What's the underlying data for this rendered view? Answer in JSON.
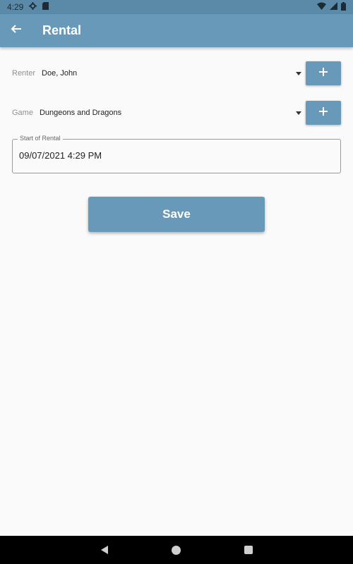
{
  "status_bar": {
    "time": "4:29",
    "icons": [
      "gear-icon",
      "sd-card-icon",
      "wifi-icon",
      "signal-icon",
      "battery-icon"
    ]
  },
  "app_bar": {
    "title": "Rental",
    "back_icon": "arrow-back-icon",
    "color": "#6899b8"
  },
  "form": {
    "renter": {
      "label": "Renter",
      "value": "Doe, John",
      "add_label": "+"
    },
    "game": {
      "label": "Game",
      "value": "Dungeons and Dragons",
      "add_label": "+"
    },
    "start": {
      "label": "Start of Rental",
      "value": "09/07/2021 4:29 PM"
    }
  },
  "save_button": {
    "label": "Save"
  },
  "nav_bar": {
    "icons": [
      "nav-back-icon",
      "nav-home-icon",
      "nav-recents-icon"
    ]
  }
}
